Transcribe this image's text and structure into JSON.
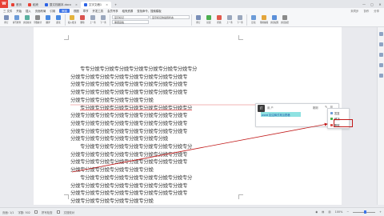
{
  "titlebar": {
    "tabs": [
      {
        "label": "首页",
        "icon": "home-icon",
        "color": "#e84135"
      },
      {
        "label": "稻壳",
        "icon": "docer-icon",
        "color": "#e84135"
      },
      {
        "label": "整文档副本.docx",
        "icon": "doc-icon",
        "color": "#2b62e6"
      },
      {
        "label": "文字文稿1",
        "icon": "doc-icon",
        "color": "#2b62e6"
      }
    ]
  },
  "menubar": {
    "items": [
      "三 文件",
      "开始",
      "插入",
      "页面布局",
      "引用",
      "审阅",
      "视图",
      "章节",
      "开发工具",
      "会员专享",
      "稻壳资源",
      "查找命令、搜索模板"
    ],
    "active_index": 5,
    "right": [
      "未同步",
      "协作",
      "分享"
    ]
  },
  "toolbar": {
    "groups1": [
      "修订",
      "拼写检查",
      "文档校对",
      "字数统计",
      "翻译",
      "朗读"
    ],
    "groups2": [
      "插入批注",
      "删除",
      "上一条",
      "下一条"
    ],
    "labels3": [
      "显示标记",
      "审阅窗格",
      "显示标记的最终状态"
    ],
    "groups4": [
      "修订",
      "接受",
      "拒绝",
      "上一条",
      "下一条"
    ],
    "groups5": [
      "比较",
      "限制编辑",
      "文档权限",
      "文档加密"
    ]
  },
  "document": {
    "lines": [
      {
        "text": "专专分娩专分娩专分娩专分娩专分娩专分娩专分娩专分",
        "indent": true
      },
      {
        "text": "分娩专分娩专分娩专分娩专分娩专分娩专分娩专分娩专",
        "indent": false
      },
      {
        "text": "分娩专分娩专分娩专分娩专分娩专分娩专分娩专分娩专",
        "indent": false
      },
      {
        "text": "分娩专分娩专分娩专分娩专分娩专分娩专分娩专分娩专",
        "indent": false
      },
      {
        "text": "分娩专分娩专分娩专分娩专分娩专分娩",
        "indent": false
      },
      {
        "text": "专分娩专分娩专分娩专分娩专分娩专分娩专分娩专分",
        "indent": true
      },
      {
        "text": "分娩专分娩专分娩专分娩专分娩专分娩专分娩专分娩专",
        "indent": false
      },
      {
        "text": "分娩专分娩专分娩专分娩专分娩专分娩专分娩专分娩专",
        "indent": false
      },
      {
        "text": "分娩专分娩专分娩专分娩专分娩专分娩专分娩专分娩专",
        "indent": false
      },
      {
        "text": "分娩专分娩专分娩专分娩专分娩专分娩专分娩",
        "indent": false
      },
      {
        "text": "专分娩专分娩专分娩专分娩专分娩专分娩专分娩专分",
        "indent": true
      },
      {
        "text": "分娩专分娩专分娩专分娩专分娩专分娩专分娩专分娩专",
        "indent": false
      },
      {
        "text": "分娩专分娩专分娩专分娩专分娩专分娩专分娩专分娩专",
        "indent": false
      },
      {
        "text": "分娩专分娩专分娩专分娩专分娩专分娩",
        "indent": false
      },
      {
        "text": "专分娩专分娩专分娩专分娩专分娩专分娩专分娩专分",
        "indent": true
      },
      {
        "text": "分娩专分娩专分娩专分娩专分娩专分娩专分娩专分娩专",
        "indent": false
      },
      {
        "text": "分娩专分娩专分娩专分娩专分娩专分娩专分娩专分娩专",
        "indent": false
      },
      {
        "text": "分娩专分娩专分娩专分娩专分娩专分娩",
        "indent": false
      }
    ]
  },
  "comment": {
    "avatar": "IT",
    "author": "用 户",
    "time": "刚刚",
    "body": "word 如注释式常见表格",
    "highlight_color": "#8fe2e2"
  },
  "dropdown": {
    "items": [
      {
        "label": "答复",
        "icon": "reply-icon"
      },
      {
        "label": "解决",
        "icon": "resolve-icon"
      },
      {
        "label": "删除",
        "icon": "delete-icon"
      }
    ]
  },
  "annotation": {
    "color": "#c11818"
  },
  "statusbar": {
    "page": "页面: 1/1",
    "words": "字数: 502",
    "spell": "拼写检查",
    "compat": "文档校对",
    "zoom": "100%"
  }
}
